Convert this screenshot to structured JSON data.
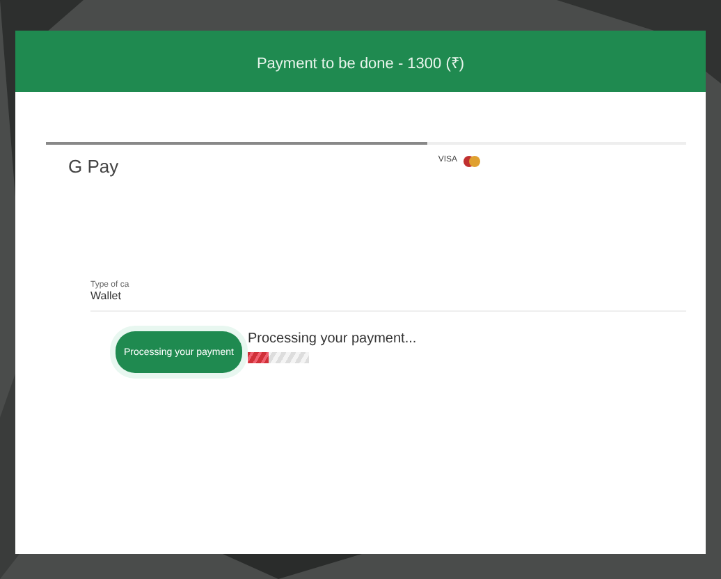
{
  "header": {
    "title": "Payment to be done - 1300 (₹)"
  },
  "tabs": [
    {
      "kind": "gpay",
      "label": "G Pay",
      "selected": true
    },
    {
      "kind": "card",
      "label": "VISA",
      "selected": false
    }
  ],
  "field": {
    "label": "Type of ca",
    "value": "Wallet"
  },
  "processing": {
    "button": "Processing your payment",
    "message": "Processing your payment...",
    "level": 0.35
  }
}
